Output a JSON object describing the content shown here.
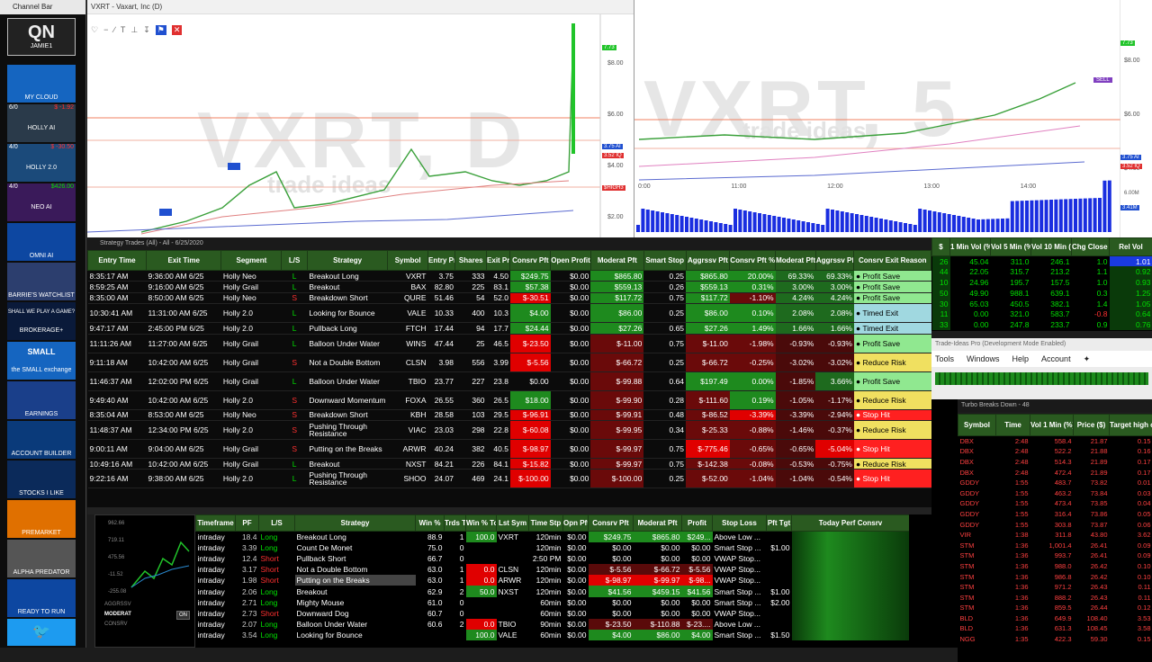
{
  "channel_bar": {
    "title": "Channel Bar",
    "items": [
      {
        "label": "QN",
        "sub": "JAMIE1"
      },
      {
        "label": "MY CLOUD"
      },
      {
        "label": "HOLLY AI",
        "count": "6/0",
        "value": "$ -1.92"
      },
      {
        "label": "HOLLY 2.0",
        "count": "4/0",
        "value": "$ -30.50"
      },
      {
        "label": "NEO AI",
        "count": "4/0",
        "value": "$426.00"
      },
      {
        "label": "OMNI AI"
      },
      {
        "label": "BARRIE'S WATCHLIST"
      },
      {
        "label": "BROKERAGE+",
        "top": "SHALL WE PLAY A GAME?"
      },
      {
        "label": "the SMALL exchange",
        "top": "SMALL"
      },
      {
        "label": "EARNINGS"
      },
      {
        "label": "ACCOUNT BUILDER"
      },
      {
        "label": "STOCKS I LIKE"
      },
      {
        "label": "PREMARKET"
      },
      {
        "label": "ALPHA PREDATOR"
      },
      {
        "label": "READY TO RUN"
      },
      {
        "label": ""
      }
    ]
  },
  "chart_daily": {
    "title": "VXRT - Vaxart, Inc (D)",
    "watermark": "VXRT, D",
    "brand": "trade ideas",
    "prices": [
      "$8.00",
      "$6.00",
      "$4.00",
      "$2.00"
    ],
    "tags": [
      "7.73",
      "3.75 AI",
      "3.52 IQ",
      "$HIGH3"
    ],
    "markers": [
      "BUY",
      "BUY"
    ]
  },
  "chart_intraday": {
    "watermark": "VXRT, 5",
    "brand": "trade ideas",
    "times": [
      "0:00",
      "11:00",
      "12:00",
      "13:00",
      "14:00"
    ],
    "prices": [
      "$8.00",
      "$6.00",
      "$4.00"
    ],
    "tags": [
      "7.73",
      "3.75 AI",
      "3.52 IQ",
      "3.41M"
    ],
    "vol_label": "6.00M",
    "sell": "SELL"
  },
  "strategy_trades": {
    "title": "Strategy Trades (All) - All - 6/25/2020",
    "columns": [
      "Entry Time",
      "Exit Time",
      "Segment",
      "L/S",
      "Strategy",
      "Symbol",
      "Entry Price",
      "Shares",
      "Exit Price",
      "Consrv Pft",
      "Open Profit",
      "Moderat Pft",
      "Smart Stop",
      "Aggrssv Pft",
      "Consrv Pft %",
      "Moderat Pft %",
      "Aggrssv Pft %",
      "Consrv Exit Reason"
    ],
    "rows": [
      [
        "8:35:17 AM",
        "9:36:00 AM 6/25",
        "Holly Neo",
        "L",
        "Breakout Long",
        "VXRT",
        "3.75",
        "333",
        "4.50",
        "$249.75",
        "$0.00",
        "$865.80",
        "0.25",
        "$865.80",
        "20.00%",
        "69.33%",
        "69.33%",
        "Profit Save"
      ],
      [
        "8:59:25 AM",
        "9:16:00 AM 6/25",
        "Holly Grail",
        "L",
        "Breakout",
        "BAX",
        "82.80",
        "225",
        "83.1",
        "$57.38",
        "$0.00",
        "$559.13",
        "0.26",
        "$559.13",
        "0.31%",
        "3.00%",
        "3.00%",
        "Profit Save"
      ],
      [
        "8:35:00 AM",
        "8:50:00 AM 6/25",
        "Holly Neo",
        "S",
        "Breakdown Short",
        "QURE",
        "51.46",
        "54",
        "52.0",
        "$-30.51",
        "$0.00",
        "$117.72",
        "0.75",
        "$117.72",
        "-1.10%",
        "4.24%",
        "4.24%",
        "Profit Save"
      ],
      [
        "10:30:41 AM",
        "11:31:00 AM 6/25",
        "Holly 2.0",
        "L",
        "Looking for Bounce",
        "VALE",
        "10.33",
        "400",
        "10.3",
        "$4.00",
        "$0.00",
        "$86.00",
        "0.25",
        "$86.00",
        "0.10%",
        "2.08%",
        "2.08%",
        "Timed Exit"
      ],
      [
        "9:47:17 AM",
        "2:45:00 PM 6/25",
        "Holly 2.0",
        "L",
        "Pullback Long",
        "FTCH",
        "17.44",
        "94",
        "17.7",
        "$24.44",
        "$0.00",
        "$27.26",
        "0.65",
        "$27.26",
        "1.49%",
        "1.66%",
        "1.66%",
        "Timed Exit"
      ],
      [
        "11:11:26 AM",
        "11:27:00 AM 6/25",
        "Holly Grail",
        "L",
        "Balloon Under Water",
        "WINS",
        "47.44",
        "25",
        "46.5",
        "$-23.50",
        "$0.00",
        "$-11.00",
        "0.75",
        "$-11.00",
        "-1.98%",
        "-0.93%",
        "-0.93%",
        "Profit Save"
      ],
      [
        "9:11:18 AM",
        "10:42:00 AM 6/25",
        "Holly Grail",
        "S",
        "Not a Double Bottom",
        "CLSN",
        "3.98",
        "556",
        "3.99",
        "$-5.56",
        "$0.00",
        "$-66.72",
        "0.25",
        "$-66.72",
        "-0.25%",
        "-3.02%",
        "-3.02%",
        "Reduce Risk"
      ],
      [
        "11:46:37 AM",
        "12:02:00 PM 6/25",
        "Holly Grail",
        "L",
        "Balloon Under Water",
        "TBIO",
        "23.77",
        "227",
        "23.8",
        "$0.00",
        "$0.00",
        "$-99.88",
        "0.64",
        "$197.49",
        "0.00%",
        "-1.85%",
        "3.66%",
        "Profit Save"
      ],
      [
        "9:49:40 AM",
        "10:42:00 AM 6/25",
        "Holly 2.0",
        "S",
        "Downward Momentum",
        "FOXA",
        "26.55",
        "360",
        "26.5",
        "$18.00",
        "$0.00",
        "$-99.90",
        "0.28",
        "$-111.60",
        "0.19%",
        "-1.05%",
        "-1.17%",
        "Reduce Risk"
      ],
      [
        "8:35:04 AM",
        "8:53:00 AM 6/25",
        "Holly Neo",
        "S",
        "Breakdown Short",
        "KBH",
        "28.58",
        "103",
        "29.5",
        "$-96.91",
        "$0.00",
        "$-99.91",
        "0.48",
        "$-86.52",
        "-3.39%",
        "-3.39%",
        "-2.94%",
        "Stop Hit"
      ],
      [
        "11:48:37 AM",
        "12:34:00 PM 6/25",
        "Holly 2.0",
        "S",
        "Pushing Through Resistance",
        "VIAC",
        "23.03",
        "298",
        "22.8",
        "$-60.08",
        "$0.00",
        "$-99.95",
        "0.34",
        "$-25.33",
        "-0.88%",
        "-1.46%",
        "-0.37%",
        "Reduce Risk"
      ],
      [
        "9:00:11 AM",
        "9:04:00 AM 6/25",
        "Holly Grail",
        "S",
        "Putting on the Breaks",
        "ARWR",
        "40.24",
        "382",
        "40.5",
        "$-98.97",
        "$0.00",
        "$-99.97",
        "0.75",
        "$-775.46",
        "-0.65%",
        "-0.65%",
        "-5.04%",
        "Stop Hit"
      ],
      [
        "10:49:16 AM",
        "10:42:00 AM 6/25",
        "Holly Grail",
        "L",
        "Breakout",
        "NXST",
        "84.21",
        "226",
        "84.1",
        "$-15.82",
        "$0.00",
        "$-99.97",
        "0.75",
        "$-142.38",
        "-0.08%",
        "-0.53%",
        "-0.75%",
        "Reduce Risk"
      ],
      [
        "9:22:16 AM",
        "9:38:00 AM 6/25",
        "Holly 2.0",
        "L",
        "Pushing Through Resistance",
        "SHOO",
        "24.07",
        "469",
        "24.1",
        "$-100.00",
        "$0.00",
        "$-100.00",
        "0.25",
        "$-52.00",
        "-1.04%",
        "-1.04%",
        "-0.54%",
        "Stop Hit"
      ]
    ]
  },
  "right_table": {
    "columns": [
      "$",
      "1 Min Vol (%)",
      "Vol 5 Min (%)",
      "Vol 10 Min (%)",
      "Chg Close (%)",
      "Rel Vol"
    ],
    "rows": [
      [
        "26",
        "45.04",
        "311.0",
        "246.1",
        "1.0",
        "1.01"
      ],
      [
        "44",
        "22.05",
        "315.7",
        "213.2",
        "1.1",
        "0.92"
      ],
      [
        "10",
        "24.96",
        "195.7",
        "157.5",
        "1.0",
        "0.93"
      ],
      [
        "50",
        "49.90",
        "988.1",
        "639.1",
        "0.3",
        "1.25"
      ],
      [
        "30",
        "65.03",
        "450.5",
        "382.1",
        "1.4",
        "1.05"
      ],
      [
        "11",
        "0.00",
        "321.0",
        "583.7",
        "-0.8",
        "0.64"
      ],
      [
        "33",
        "0.00",
        "247.8",
        "233.7",
        "0.9",
        "0.76"
      ]
    ]
  },
  "trade_ideas_pro": {
    "title": "Trade-Ideas Pro (Development Mode Enabled)",
    "menu": [
      "Tools",
      "Windows",
      "Help",
      "Account"
    ]
  },
  "turbo_breaks": {
    "title": "Turbo Breaks Down - 48",
    "columns": [
      "Symbol",
      "Time",
      "Vol 1 Min (%)",
      "Price ($)",
      "Target high or Low ($)"
    ],
    "rows": [
      [
        "DBX",
        "2:48",
        "558.4",
        "21.87",
        "0.15"
      ],
      [
        "DBX",
        "2:48",
        "522.2",
        "21.88",
        "0.16"
      ],
      [
        "DBX",
        "2:48",
        "514.3",
        "21.89",
        "0.17"
      ],
      [
        "DBX",
        "2:48",
        "472.4",
        "21.89",
        "0.17"
      ],
      [
        "GDDY",
        "1:55",
        "483.7",
        "73.82",
        "0.01"
      ],
      [
        "GDDY",
        "1:55",
        "463.2",
        "73.84",
        "0.03"
      ],
      [
        "GDDY",
        "1:55",
        "473.4",
        "73.85",
        "0.04"
      ],
      [
        "GDDY",
        "1:55",
        "316.4",
        "73.86",
        "0.05"
      ],
      [
        "GDDY",
        "1:55",
        "303.8",
        "73.87",
        "0.06"
      ],
      [
        "VIR",
        "1:38",
        "311.8",
        "43.80",
        "3.62"
      ],
      [
        "STM",
        "1:36",
        "1,001.4",
        "26.41",
        "0.09"
      ],
      [
        "STM",
        "1:36",
        "993.7",
        "26.41",
        "0.09"
      ],
      [
        "STM",
        "1:36",
        "988.0",
        "26.42",
        "0.10"
      ],
      [
        "STM",
        "1:36",
        "986.8",
        "26.42",
        "0.10"
      ],
      [
        "STM",
        "1:36",
        "971.2",
        "26.43",
        "0.11"
      ],
      [
        "STM",
        "1:36",
        "888.2",
        "26.43",
        "0.11"
      ],
      [
        "STM",
        "1:36",
        "859.5",
        "26.44",
        "0.12"
      ],
      [
        "BLD",
        "1:36",
        "649.9",
        "108.40",
        "3.53"
      ],
      [
        "BLD",
        "1:36",
        "631.3",
        "108.45",
        "3.58"
      ],
      [
        "NGG",
        "1:35",
        "422.3",
        "59.30",
        "0.15"
      ]
    ]
  },
  "performance": {
    "columns": [
      "Timeframe",
      "PF",
      "L/S",
      "Strategy",
      "Win %",
      "Trds Today",
      "Win % Today",
      "Lst Sym",
      "Time Stp",
      "Opn Pft",
      "Consrv Pft",
      "Moderat Pft",
      "Profit",
      "Stop Loss",
      "Pft Tgt",
      "Today Perf Consrv"
    ],
    "rows": [
      [
        "intraday",
        "18.4",
        "Long",
        "Breakout Long",
        "88.9",
        "1",
        "100.0",
        "VXRT",
        "120min",
        "$0.00",
        "$249.75",
        "$865.80",
        "$249...",
        "Above Low ...",
        ""
      ],
      [
        "intraday",
        "3.39",
        "Long",
        "Count De Monet",
        "75.0",
        "0",
        "",
        "",
        "120min",
        "$0.00",
        "$0.00",
        "$0.00",
        "$0.00",
        "Smart Stop ...",
        "$1.00"
      ],
      [
        "intraday",
        "12.4",
        "Short",
        "Pullback Short",
        "66.7",
        "0",
        "",
        "",
        "2:50 PM",
        "$0.00",
        "$0.00",
        "$0.00",
        "$0.00",
        "VWAP Stop...",
        ""
      ],
      [
        "intraday",
        "3.17",
        "Short",
        "Not a Double Bottom",
        "63.0",
        "1",
        "0.0",
        "CLSN",
        "120min",
        "$0.00",
        "$-5.56",
        "$-66.72",
        "$-5.56",
        "VWAP Stop...",
        ""
      ],
      [
        "intraday",
        "1.98",
        "Short",
        "Putting on the Breaks",
        "63.0",
        "1",
        "0.0",
        "ARWR",
        "120min",
        "$0.00",
        "$-98.97",
        "$-99.97",
        "$-98...",
        "VWAP Stop...",
        ""
      ],
      [
        "intraday",
        "2.06",
        "Long",
        "Breakout",
        "62.9",
        "2",
        "50.0",
        "NXST",
        "120min",
        "$0.00",
        "$41.56",
        "$459.15",
        "$41.56",
        "Smart Stop ...",
        "$1.00"
      ],
      [
        "intraday",
        "2.71",
        "Long",
        "Mighty Mouse",
        "61.0",
        "0",
        "",
        "",
        "60min",
        "$0.00",
        "$0.00",
        "$0.00",
        "$0.00",
        "Smart Stop ...",
        "$2.00"
      ],
      [
        "intraday",
        "2.73",
        "Short",
        "Downward Dog",
        "60.7",
        "0",
        "",
        "",
        "60min",
        "$0.00",
        "$0.00",
        "$0.00",
        "$0.00",
        "VWAP Stop...",
        ""
      ],
      [
        "intraday",
        "2.07",
        "Long",
        "Balloon Under Water",
        "60.6",
        "2",
        "0.0",
        "TBIO",
        "90min",
        "$0.00",
        "$-23.50",
        "$-110.88",
        "$-23....",
        "Above Low ...",
        ""
      ],
      [
        "intraday",
        "3.54",
        "Long",
        "Looking for Bounce",
        "",
        "",
        "100.0",
        "VALE",
        "60min",
        "$0.00",
        "$4.00",
        "$86.00",
        "$4.00",
        "Smart Stop ...",
        "$1.50"
      ]
    ],
    "mini": {
      "prices": [
        "962.66",
        "719.11",
        "475.56",
        "-11.52",
        "-255.08"
      ],
      "legend": [
        "AGGRSSV",
        "MODERAT",
        "CONSRV"
      ],
      "on": "ON"
    }
  },
  "colors": {
    "header": "#2a5a20",
    "green": "#00e000",
    "red": "#ff3030",
    "accent": "#1e8a1e"
  }
}
